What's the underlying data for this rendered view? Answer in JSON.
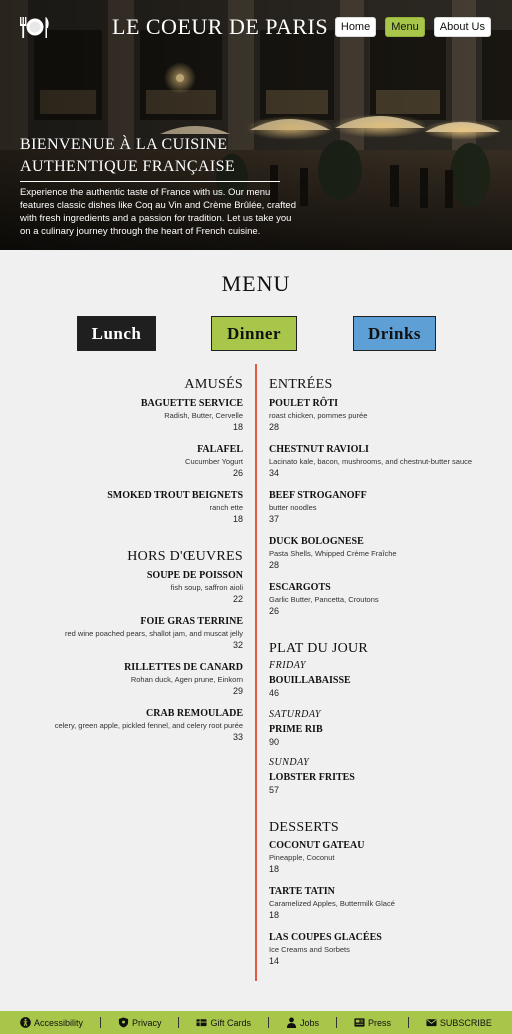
{
  "header": {
    "site_title": "LE COEUR DE PARIS",
    "nav": [
      "Home",
      "Menu",
      "About Us"
    ],
    "active_nav": "Menu"
  },
  "hero": {
    "heading": "Bienvenue à la Cuisine Authentique Française",
    "text": "Experience the authentic taste of France with us. Our menu features classic dishes like Coq au Vin and Crème Brûlée, crafted with fresh ingredients and a passion for tradition. Let us take you on a culinary journey through the heart of French cuisine."
  },
  "menu": {
    "title": "MENU",
    "tabs": [
      "Lunch",
      "Dinner",
      "Drinks"
    ],
    "sections_left": [
      {
        "title": "Amusés",
        "items": [
          {
            "name": "Baguette Service",
            "desc": "Radish, Butter, Cervelle",
            "price": "18"
          },
          {
            "name": "Falafel",
            "desc": "Cucumber Yogurt",
            "price": "26"
          },
          {
            "name": "Smoked Trout Beignets",
            "desc": "ranch ette",
            "price": "18"
          }
        ]
      },
      {
        "title": "Hors d'Œuvres",
        "items": [
          {
            "name": "Soupe de Poisson",
            "desc": "fish soup, saffron aioli",
            "price": "22"
          },
          {
            "name": "Foie Gras Terrine",
            "desc": "red wine poached pears, shallot jam, and muscat jelly",
            "price": "32"
          },
          {
            "name": "Rillettes de Canard",
            "desc": "Rohan duck, Agen prune, Einkorn",
            "price": "29"
          },
          {
            "name": "Crab Remoulade",
            "desc": "celery, green apple, pickled fennel, and celery root purée",
            "price": "33"
          }
        ]
      }
    ],
    "entrees": {
      "title": "Entrées",
      "items": [
        {
          "name": "Poulet Rôti",
          "desc": "roast chicken, pommes purée",
          "price": "28"
        },
        {
          "name": "Chestnut Ravioli",
          "desc": "Lacinato kale, bacon, mushrooms, and chestnut-butter sauce",
          "price": "34"
        },
        {
          "name": "Beef Stroganoff",
          "desc": "butter noodles",
          "price": "37"
        },
        {
          "name": "Duck Bolognese",
          "desc": "Pasta Shells, Whipped Crème Fraîche",
          "price": "28"
        },
        {
          "name": "Escargots",
          "desc": "Garlic Butter, Pancetta, Croutons",
          "price": "26"
        }
      ]
    },
    "plat_du_jour": {
      "title": "Plat du Jour",
      "items": [
        {
          "day": "Friday",
          "name": "Bouillabaisse",
          "price": "46"
        },
        {
          "day": "Saturday",
          "name": "Prime Rib",
          "price": "90"
        },
        {
          "day": "Sunday",
          "name": "Lobster Frites",
          "price": "57"
        }
      ]
    },
    "desserts": {
      "title": "Desserts",
      "items": [
        {
          "name": "Coconut Gateau",
          "desc": "Pineapple, Coconut",
          "price": "18"
        },
        {
          "name": "Tarte Tatin",
          "desc": "Caramelized Apples, Buttermilk Glacé",
          "price": "18"
        },
        {
          "name": "Las Coupes Glacées",
          "desc": "Ice Creams and Sorbets",
          "price": "14"
        }
      ]
    }
  },
  "footer": {
    "links": [
      {
        "label": "Accessibility",
        "icon": "accessibility-icon"
      },
      {
        "label": "Privacy",
        "icon": "shield-icon"
      },
      {
        "label": "Gift Cards",
        "icon": "gift-card-icon"
      },
      {
        "label": "Jobs",
        "icon": "person-icon"
      },
      {
        "label": "Press",
        "icon": "newspaper-icon"
      },
      {
        "label": "SUBSCRIBE",
        "icon": "mail-icon"
      }
    ]
  },
  "colors": {
    "accent_green": "#a8c64a",
    "accent_blue": "#5ea0d6",
    "divider_red": "#e05a43",
    "dark": "#1f1f1f"
  }
}
